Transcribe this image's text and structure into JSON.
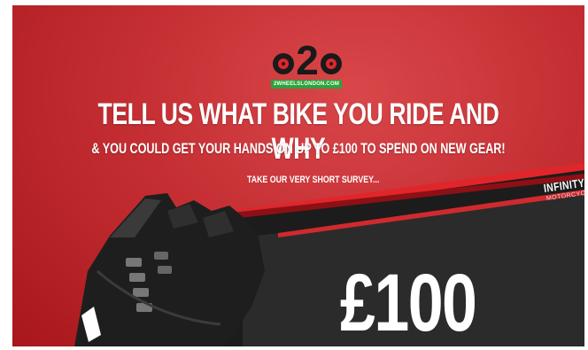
{
  "logo": {
    "wordmark": "2WHEELSLONDON.COM",
    "icon": "two-wheels-logo-icon"
  },
  "headline": "TELL US WHAT BIKE YOU RIDE AND WHY",
  "subline": "& YOU COULD GET YOUR HANDS ON UP TO £100 TO SPEND ON NEW GEAR!",
  "survey_cta": "TAKE OUR VERY SHORT SURVEY...",
  "card": {
    "amount": "£100",
    "brand": "INFINITY",
    "brand_sub": "MOTORCYCLES"
  },
  "colors": {
    "background_red": "#c52f33",
    "card_dark": "#2a2a2a",
    "logo_green": "#2fa13b"
  }
}
